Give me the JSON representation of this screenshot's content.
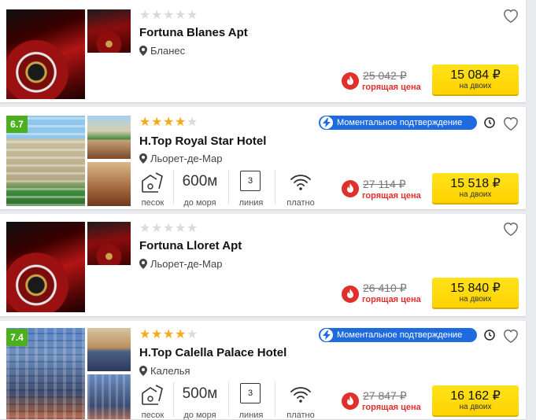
{
  "colors": {
    "score_badge": "#4caf1f",
    "star_active": "#f7a81b",
    "instant_badge": "#1e6ae0",
    "hot_price": "#e0302b",
    "price_button": "#ffd200"
  },
  "hotels": [
    {
      "name": "Fortuna Blanes Apt",
      "location": "Бланес",
      "stars": 0,
      "old_price": "25 042 ₽",
      "hot_label": "горящая цена",
      "price": "15 084 ₽",
      "price_sub": "на двоих"
    },
    {
      "score": "6.7",
      "name": "H.Top Royal Star Hotel",
      "location": "Льорет-де-Мар",
      "stars": 4,
      "instant_label": "Моментальное подтверждение",
      "beach_label": "песок",
      "distance_value": "600м",
      "distance_label": "до моря",
      "line_value": "3",
      "line_label": "линия",
      "wifi_label": "платно",
      "old_price": "27 114 ₽",
      "hot_label": "горящая цена",
      "price": "15 518 ₽",
      "price_sub": "на двоих"
    },
    {
      "name": "Fortuna Lloret Apt",
      "location": "Льорет-де-Мар",
      "stars": 0,
      "old_price": "26 410 ₽",
      "hot_label": "горящая цена",
      "price": "15 840 ₽",
      "price_sub": "на двоих"
    },
    {
      "score": "7.4",
      "name": "H.Top Calella Palace Hotel",
      "location": "Калелья",
      "stars": 4,
      "instant_label": "Моментальное подтверждение",
      "beach_label": "песок",
      "distance_value": "500м",
      "distance_label": "до моря",
      "line_value": "3",
      "line_label": "линия",
      "wifi_label": "платно",
      "old_price": "27 847 ₽",
      "hot_label": "горящая цена",
      "price": "16 162 ₽",
      "price_sub": "на двоих"
    }
  ]
}
